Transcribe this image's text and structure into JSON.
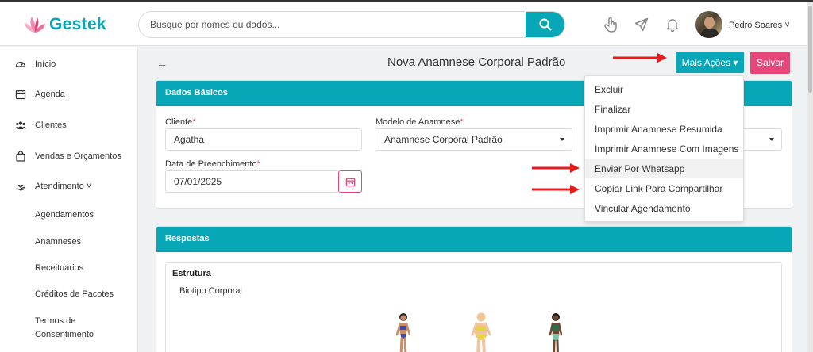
{
  "header": {
    "logo_text": "Gestek",
    "search": {
      "placeholder": "Busque por nomes ou dados...",
      "value": ""
    },
    "user_name": "Pedro Soares ˅"
  },
  "sidebar": {
    "items": [
      {
        "label": "Início",
        "icon": "gauge-icon"
      },
      {
        "label": "Agenda",
        "icon": "calendar-icon"
      },
      {
        "label": "Clientes",
        "icon": "users-icon"
      },
      {
        "label": "Vendas e Orçamentos",
        "icon": "shopping-bag-icon"
      },
      {
        "label": "Atendimento ˅",
        "icon": "hand-heart-icon"
      }
    ],
    "subitems": [
      "Agendamentos",
      "Anamneses",
      "Receituários",
      "Créditos de Pacotes",
      "Termos de Consentimento"
    ]
  },
  "page": {
    "back": "←",
    "title": "Nova Anamnese Corporal Padrão",
    "mais_acoes": "Mais Ações ▾",
    "salvar": "Salvar"
  },
  "dados_basicos": {
    "header": "Dados Básicos",
    "cliente_label": "Cliente",
    "cliente_value": "Agatha",
    "modelo_label": "Modelo de Anamnese",
    "modelo_value": "Anamnese Corporal Padrão",
    "data_label": "Data de Preenchimento",
    "data_value": "07/01/2025",
    "required_mark": "*"
  },
  "respostas": {
    "header": "Respostas",
    "section": "Estrutura",
    "question": "Biotipo Corporal"
  },
  "dropdown": {
    "items": [
      "Excluir",
      "Finalizar",
      "Imprimir Anamnese Resumida",
      "Imprimir Anamnese Com Imagens",
      "Enviar Por Whatsapp",
      "Copiar Link Para Compartilhar",
      "Vincular Agendamento"
    ],
    "highlighted_index": 4
  },
  "colors": {
    "accent": "#07a7b7",
    "pink": "#e6477b",
    "arrow_red": "#e31c1c"
  }
}
